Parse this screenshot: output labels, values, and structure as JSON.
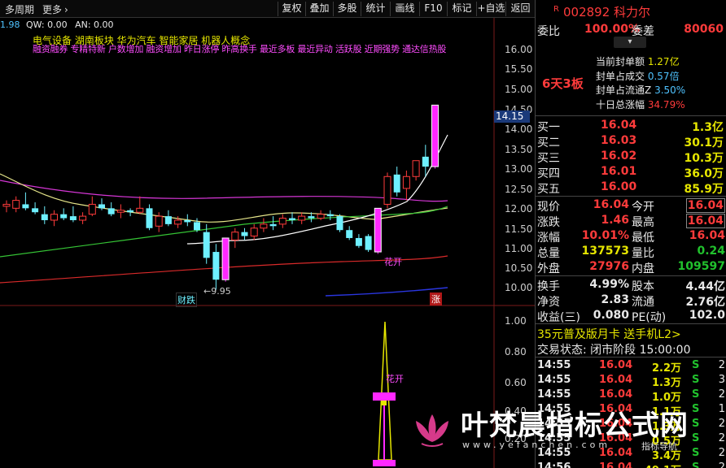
{
  "toolbar": {
    "period_label": "多周期",
    "more_label": "更多",
    "buttons": [
      "复权",
      "叠加",
      "多股",
      "统计",
      "画线",
      "F10",
      "标记",
      "+自选",
      "返回"
    ]
  },
  "indicator_line": {
    "left_value": "1.98",
    "qw": "QW: 0.00",
    "an": "AN: 0.00"
  },
  "concepts_line1": "电气设备  湖南板块  华为汽车 智能家居 机器人概念",
  "concepts_line2": "融资融券 专精特新 户数增加 融资增加 昨日涨停 昨高换手 最近多板 最近异动 活跃股 近期强势 通达信热股",
  "price_axis": [
    "16.00",
    "15.50",
    "15.00",
    "14.50",
    "14.00",
    "13.50",
    "13.00",
    "12.50",
    "12.00",
    "11.50",
    "11.00",
    "10.50",
    "10.00"
  ],
  "current_price_tag": "14.15",
  "low_label": "9.95",
  "tags": {
    "caidie": "财跌",
    "huakai_top": "花开",
    "zhang": "涨",
    "huakai_bottom": "花开"
  },
  "lower_axis": [
    "1.00",
    "0.80",
    "0.60",
    "0.40",
    "0.20"
  ],
  "colors": {
    "up": "#ff3b3b",
    "down": "#21c12d",
    "magenta": "#ff28ff",
    "cyan_candle": "#6ef0ff"
  },
  "stock": {
    "marker": "R",
    "code_name": "002892 科力尔",
    "weibi_label": "委比",
    "weibi_value": "100.00%",
    "weicha_label": "委差",
    "weicha_value": "80060",
    "board": "6天3板",
    "seal_rows": [
      {
        "label": "当前封单额",
        "value": "1.27亿"
      },
      {
        "label": "封单占成交",
        "value": "0.57倍"
      },
      {
        "label": "封单占流通Z",
        "value": "3.50%"
      },
      {
        "label": "十日总涨幅",
        "value": "34.79%"
      }
    ],
    "bids": [
      {
        "label": "买一",
        "price": "16.04",
        "vol": "1.3亿"
      },
      {
        "label": "买二",
        "price": "16.03",
        "vol": "30.1万"
      },
      {
        "label": "买三",
        "price": "16.02",
        "vol": "10.3万"
      },
      {
        "label": "买四",
        "price": "16.01",
        "vol": "36.0万"
      },
      {
        "label": "买五",
        "price": "16.00",
        "vol": "85.9万"
      }
    ],
    "quote": [
      {
        "l1": "现价",
        "v1": "16.04",
        "l2": "今开",
        "v2": "16.04"
      },
      {
        "l1": "涨跌",
        "v1": "1.46",
        "l2": "最高",
        "v2": "16.04"
      },
      {
        "l1": "涨幅",
        "v1": "10.01%",
        "l2": "最低",
        "v2": "16.04"
      },
      {
        "l1": "总量",
        "v1": "137573",
        "l2": "量比",
        "v2": "0.24"
      },
      {
        "l1": "外盘",
        "v1": "27976",
        "l2": "内盘",
        "v2": "109597"
      }
    ],
    "fund": [
      {
        "l1": "换手",
        "v1": "4.99%",
        "l2": "股本",
        "v2": "4.44亿"
      },
      {
        "l1": "净资",
        "v1": "2.83",
        "l2": "流通",
        "v2": "2.76亿"
      },
      {
        "l1": "收益(三)",
        "v1": "0.080",
        "l2": "PE(动)",
        "v2": "102.0"
      }
    ],
    "promo": "35元普及版月卡 送手机L2>",
    "status_label": "交易状态:",
    "status_value": "闭市阶段 15:00:00",
    "ticks": [
      {
        "time": "14:55",
        "price": "16.04",
        "vol": "2.2万",
        "side": "S",
        "n": "2"
      },
      {
        "time": "14:55",
        "price": "16.04",
        "vol": "1.3万",
        "side": "S",
        "n": "3"
      },
      {
        "time": "14:55",
        "price": "16.04",
        "vol": "1.0万",
        "side": "S",
        "n": "2"
      },
      {
        "time": "14:55",
        "price": "16.04",
        "vol": "1.1万",
        "side": "S",
        "n": "1"
      },
      {
        "time": "14:55",
        "price": "16.04",
        "vol": "1.3万",
        "side": "S",
        "n": "2"
      },
      {
        "time": "14:55",
        "price": "16.04",
        "vol": "0.5万",
        "side": "S",
        "n": "2"
      },
      {
        "time": "14:55",
        "price": "16.04",
        "vol": "3.4万",
        "side": "S",
        "n": "2"
      },
      {
        "time": "14:56",
        "price": "16.04",
        "vol": "49.1万",
        "side": "S",
        "n": "2"
      }
    ]
  },
  "watermark": {
    "title": "叶梵晨指标公式网",
    "url": "www.yefanchen.com",
    "sub": "指标导航"
  },
  "chart_data": {
    "type": "candlestick",
    "y_range": [
      9.8,
      16.3
    ],
    "note_values": "approximate OHLC read from the price axis",
    "candles": [
      {
        "o": 12.05,
        "h": 12.2,
        "l": 11.9,
        "c": 12.1
      },
      {
        "o": 12.0,
        "h": 12.3,
        "l": 11.9,
        "c": 12.2
      },
      {
        "o": 12.1,
        "h": 12.4,
        "l": 11.95,
        "c": 12.0
      },
      {
        "o": 12.0,
        "h": 12.15,
        "l": 11.85,
        "c": 11.9
      },
      {
        "o": 11.85,
        "h": 12.05,
        "l": 11.6,
        "c": 11.7
      },
      {
        "o": 11.7,
        "h": 11.95,
        "l": 11.55,
        "c": 11.85
      },
      {
        "o": 11.85,
        "h": 12.0,
        "l": 11.7,
        "c": 11.75
      },
      {
        "o": 11.8,
        "h": 12.05,
        "l": 11.65,
        "c": 11.7
      },
      {
        "o": 11.7,
        "h": 11.9,
        "l": 11.6,
        "c": 11.8
      },
      {
        "o": 11.85,
        "h": 12.3,
        "l": 11.8,
        "c": 12.1
      },
      {
        "o": 12.1,
        "h": 12.25,
        "l": 11.95,
        "c": 12.0
      },
      {
        "o": 12.0,
        "h": 12.15,
        "l": 11.8,
        "c": 11.85
      },
      {
        "o": 11.9,
        "h": 12.1,
        "l": 11.75,
        "c": 11.95
      },
      {
        "o": 11.95,
        "h": 12.0,
        "l": 11.8,
        "c": 11.9
      },
      {
        "o": 11.9,
        "h": 12.3,
        "l": 11.85,
        "c": 12.0
      },
      {
        "o": 12.0,
        "h": 12.1,
        "l": 11.45,
        "c": 11.5
      },
      {
        "o": 11.55,
        "h": 11.9,
        "l": 11.4,
        "c": 11.8
      },
      {
        "o": 11.8,
        "h": 11.95,
        "l": 11.55,
        "c": 11.6
      },
      {
        "o": 11.6,
        "h": 11.8,
        "l": 11.5,
        "c": 11.7
      },
      {
        "o": 11.7,
        "h": 11.85,
        "l": 11.55,
        "c": 11.65
      },
      {
        "o": 11.65,
        "h": 11.75,
        "l": 11.4,
        "c": 11.45
      },
      {
        "o": 11.4,
        "h": 11.6,
        "l": 10.6,
        "c": 10.75
      },
      {
        "o": 10.9,
        "h": 11.1,
        "l": 9.95,
        "c": 10.2
      },
      {
        "o": 10.2,
        "h": 11.25,
        "l": 10.15,
        "c": 11.25
      },
      {
        "o": 11.2,
        "h": 11.5,
        "l": 11.0,
        "c": 11.4
      },
      {
        "o": 11.4,
        "h": 11.5,
        "l": 11.2,
        "c": 11.3
      },
      {
        "o": 11.3,
        "h": 11.6,
        "l": 11.2,
        "c": 11.5
      },
      {
        "o": 11.5,
        "h": 11.75,
        "l": 11.4,
        "c": 11.6
      },
      {
        "o": 11.6,
        "h": 11.8,
        "l": 11.45,
        "c": 11.55
      },
      {
        "o": 11.6,
        "h": 11.85,
        "l": 11.5,
        "c": 11.75
      },
      {
        "o": 11.75,
        "h": 11.9,
        "l": 11.6,
        "c": 11.7
      },
      {
        "o": 11.7,
        "h": 11.9,
        "l": 11.6,
        "c": 11.8
      },
      {
        "o": 11.8,
        "h": 11.9,
        "l": 11.65,
        "c": 11.75
      },
      {
        "o": 11.75,
        "h": 11.95,
        "l": 11.7,
        "c": 11.85
      },
      {
        "o": 11.85,
        "h": 11.95,
        "l": 11.7,
        "c": 11.8
      },
      {
        "o": 11.8,
        "h": 11.85,
        "l": 11.4,
        "c": 11.45
      },
      {
        "o": 11.45,
        "h": 11.55,
        "l": 11.2,
        "c": 11.25
      },
      {
        "o": 11.25,
        "h": 11.35,
        "l": 11.0,
        "c": 11.05
      },
      {
        "o": 11.3,
        "h": 11.35,
        "l": 10.9,
        "c": 10.95
      },
      {
        "o": 10.9,
        "h": 12.0,
        "l": 10.85,
        "c": 12.0
      },
      {
        "o": 12.1,
        "h": 12.9,
        "l": 12.0,
        "c": 12.8
      },
      {
        "o": 12.85,
        "h": 13.05,
        "l": 12.3,
        "c": 12.4
      },
      {
        "o": 12.5,
        "h": 12.95,
        "l": 12.2,
        "c": 12.8
      },
      {
        "o": 12.8,
        "h": 13.2,
        "l": 12.7,
        "c": 13.2
      },
      {
        "o": 13.3,
        "h": 13.6,
        "l": 12.8,
        "c": 13.05
      },
      {
        "o": 13.05,
        "h": 14.6,
        "l": 13.0,
        "c": 14.6
      }
    ]
  }
}
